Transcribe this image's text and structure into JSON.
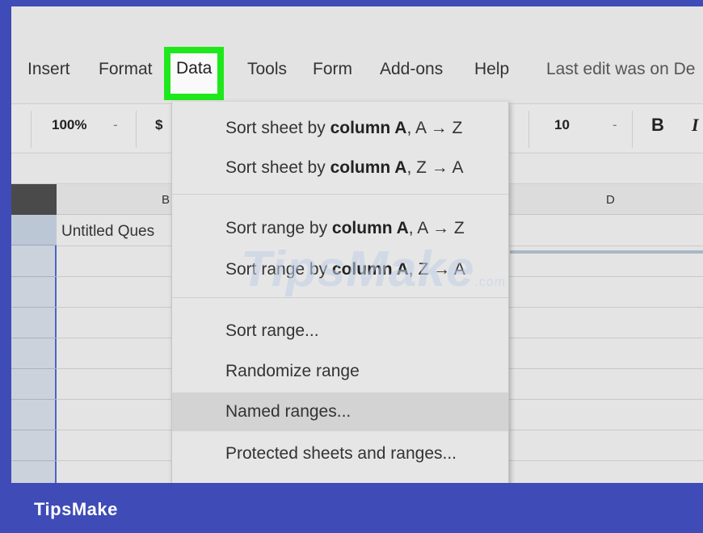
{
  "menu": {
    "items": [
      {
        "label": "Insert"
      },
      {
        "label": "Format"
      },
      {
        "label": "Data"
      },
      {
        "label": "Tools"
      },
      {
        "label": "Form"
      },
      {
        "label": "Add-ons"
      },
      {
        "label": "Help"
      }
    ],
    "last_edit": "Last edit was on De",
    "highlight_color": "#1ee81b"
  },
  "toolbar": {
    "zoom": "100%",
    "currency": "$",
    "font_size": "10",
    "bold": "B",
    "italic": "I",
    "dropdown_caret": "-"
  },
  "grid": {
    "columns": [
      "B",
      "D"
    ],
    "cell_b1": "Untitled Ques"
  },
  "dropdown": {
    "items": [
      {
        "prefix": "Sort sheet by ",
        "bold": "column A",
        "suffix": ", A → Z"
      },
      {
        "prefix": "Sort sheet by ",
        "bold": "column A",
        "suffix": ", Z → A"
      },
      {
        "prefix": "Sort range by ",
        "bold": "column A",
        "suffix": ", A → Z"
      },
      {
        "prefix": "Sort range by ",
        "bold": "column A",
        "suffix": ", Z → A"
      },
      {
        "label": "Sort range..."
      },
      {
        "label": "Randomize range"
      },
      {
        "label": "Named ranges..."
      },
      {
        "label": "Protected sheets and ranges..."
      }
    ]
  },
  "watermark": {
    "text": "TipsMake",
    "suffix": ".com"
  },
  "footer": {
    "brand": "TipsMake"
  }
}
